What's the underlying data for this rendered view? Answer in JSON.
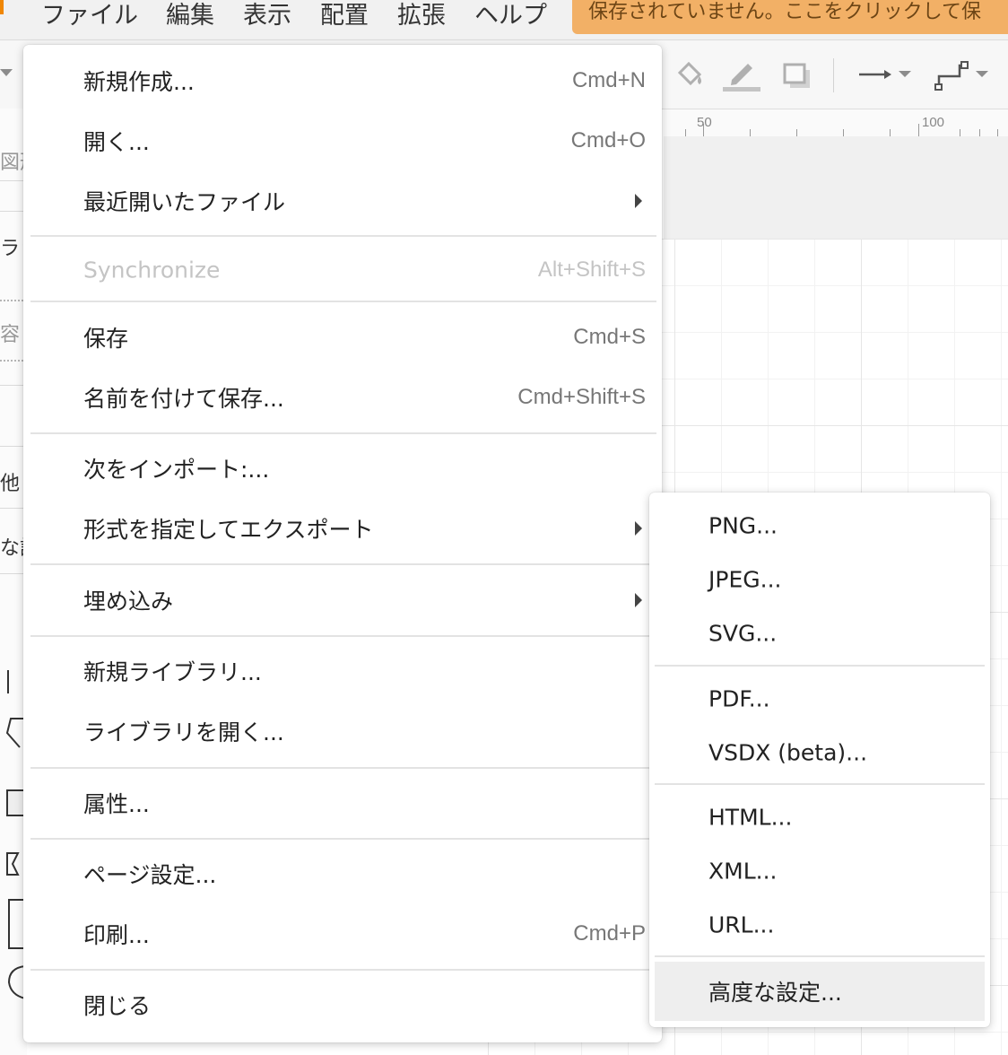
{
  "menubar": {
    "items": [
      "ファイル",
      "編集",
      "表示",
      "配置",
      "拡張",
      "ヘルプ"
    ],
    "unsaved_notice": "保存されていません。ここをクリックして保"
  },
  "ruler": {
    "labels": [
      "50",
      "100"
    ]
  },
  "sidebar": {
    "fragments": [
      "図形",
      "ラッ",
      "容",
      "他",
      "な設"
    ]
  },
  "file_menu": {
    "items": [
      {
        "label": "新規作成...",
        "shortcut": "Cmd+N"
      },
      {
        "label": "開く...",
        "shortcut": "Cmd+O"
      },
      {
        "label": "最近開いたファイル",
        "submenu": true
      },
      {
        "label": "Synchronize",
        "shortcut": "Alt+Shift+S",
        "disabled": true
      },
      {
        "label": "保存",
        "shortcut": "Cmd+S"
      },
      {
        "label": "名前を付けて保存...",
        "shortcut": "Cmd+Shift+S"
      },
      {
        "label": "次をインポート:..."
      },
      {
        "label": "形式を指定してエクスポート",
        "submenu": true
      },
      {
        "label": "埋め込み",
        "submenu": true
      },
      {
        "label": "新規ライブラリ..."
      },
      {
        "label": "ライブラリを開く..."
      },
      {
        "label": "属性..."
      },
      {
        "label": "ページ設定..."
      },
      {
        "label": "印刷...",
        "shortcut": "Cmd+P"
      },
      {
        "label": "閉じる"
      }
    ]
  },
  "export_submenu": {
    "items": [
      "PNG...",
      "JPEG...",
      "SVG...",
      "PDF...",
      "VSDX (beta)...",
      "HTML...",
      "XML...",
      "URL...",
      "高度な設定..."
    ],
    "hovered": "高度な設定..."
  }
}
